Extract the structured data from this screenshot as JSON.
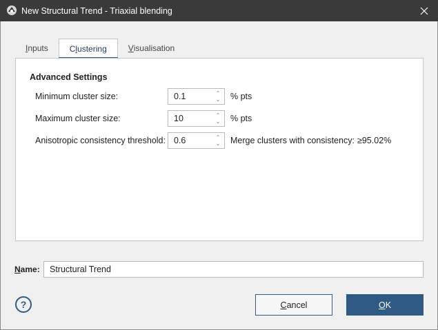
{
  "window": {
    "title": "New Structural Trend - Triaxial blending",
    "titlebar_color": "#3a3a3a",
    "app_icon": "leapfrog-app-icon",
    "close_icon": "close-icon"
  },
  "tabs": [
    {
      "label_pre": "",
      "label_ul": "I",
      "label_post": "nputs",
      "active": false
    },
    {
      "label_pre": "C",
      "label_ul": "l",
      "label_post": "ustering",
      "active": true
    },
    {
      "label_pre": "",
      "label_ul": "V",
      "label_post": "isualisation",
      "active": false
    }
  ],
  "advanced": {
    "title": "Advanced Settings",
    "min_cluster": {
      "label": "Minimum cluster size:",
      "value": "0.1",
      "unit": "% pts"
    },
    "max_cluster": {
      "label": "Maximum cluster size:",
      "value": "10",
      "unit": "% pts"
    },
    "anisotropic": {
      "label": "Anisotropic consistency threshold:",
      "value": "0.6",
      "merge_label": "Merge clusters with consistency:",
      "merge_value": "≥95.02%"
    }
  },
  "name_field": {
    "label_ul": "N",
    "label_post": "ame:",
    "value": "Structural Trend"
  },
  "buttons": {
    "help_glyph": "?",
    "cancel_ul": "C",
    "cancel_post": "ancel",
    "ok_ul": "O",
    "ok_post": "K"
  },
  "colors": {
    "accent": "#2e5a84",
    "panel_bg": "#ffffff",
    "dialog_bg": "#f0f0f0"
  }
}
